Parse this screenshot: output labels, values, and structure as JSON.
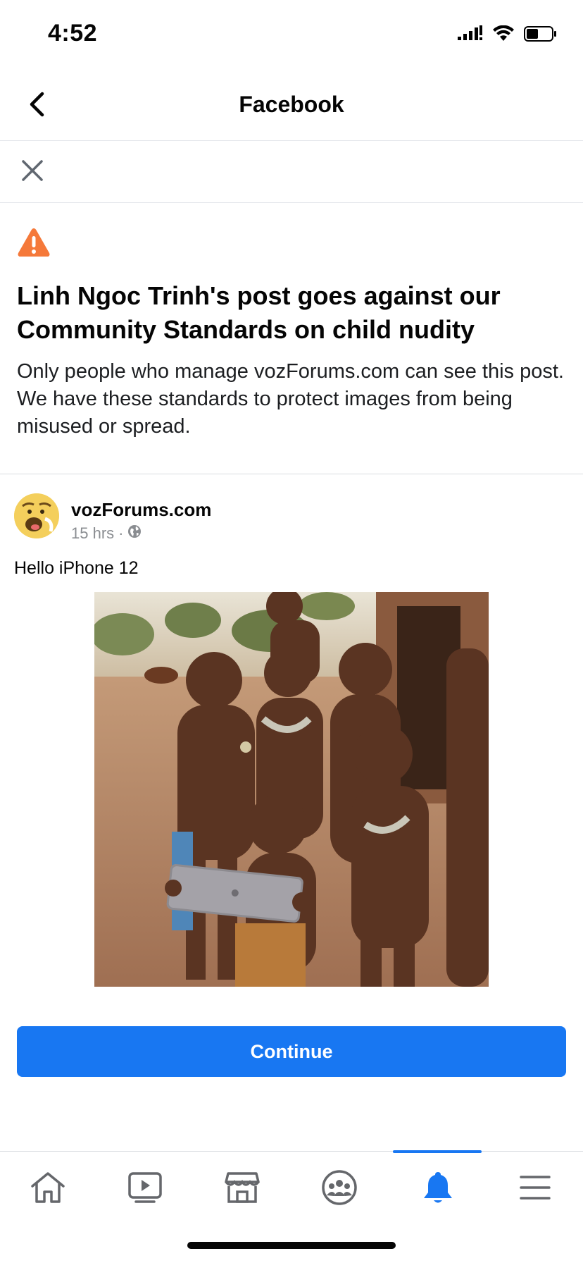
{
  "status_bar": {
    "time": "4:52"
  },
  "nav": {
    "title": "Facebook"
  },
  "warning": {
    "title": "Linh Ngoc Trinh's post goes against our Community Standards on child nudity",
    "description": "Only people who manage vozForums.com can see this post.  We have these standards to protect images from being misused or spread.",
    "icon_color": "#f5793a"
  },
  "post": {
    "author": "vozForums.com",
    "time": "15 hrs",
    "separator": "·",
    "privacy_icon": "globe-icon",
    "text": "Hello iPhone 12"
  },
  "actions": {
    "continue_label": "Continue"
  },
  "tab_bar": {
    "tabs": [
      {
        "icon": "home-icon"
      },
      {
        "icon": "watch-icon"
      },
      {
        "icon": "marketplace-icon"
      },
      {
        "icon": "groups-icon"
      },
      {
        "icon": "bell-icon",
        "active": true
      },
      {
        "icon": "menu-icon"
      }
    ],
    "active_color": "#1877f2"
  }
}
